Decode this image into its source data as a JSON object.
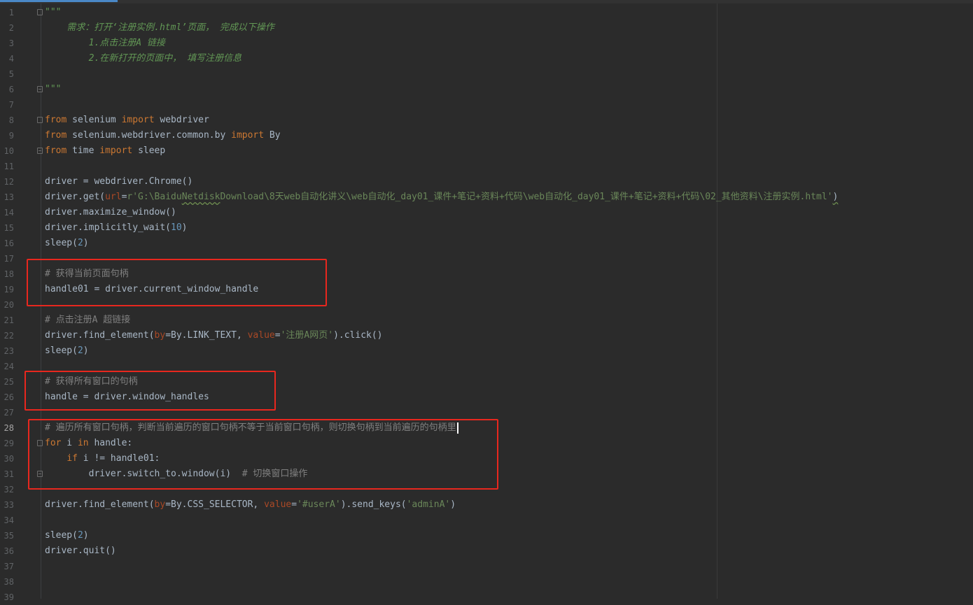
{
  "editor": {
    "current_line": "28",
    "lines": [
      {
        "n": "1",
        "code": [
          {
            "t": "\"\"\"",
            "c": "doc"
          }
        ],
        "fold": "open"
      },
      {
        "n": "2",
        "code": [
          {
            "t": "    需求：打开‘注册实例.html’页面， 完成以下操作",
            "c": "doc"
          }
        ]
      },
      {
        "n": "3",
        "code": [
          {
            "t": "        1.点击注册A 链接",
            "c": "doc"
          }
        ]
      },
      {
        "n": "4",
        "code": [
          {
            "t": "        2.在新打开的页面中， 填写注册信息",
            "c": "doc"
          }
        ]
      },
      {
        "n": "5",
        "code": []
      },
      {
        "n": "6",
        "code": [
          {
            "t": "\"\"\"",
            "c": "doc"
          }
        ],
        "fold": "close"
      },
      {
        "n": "7",
        "code": []
      },
      {
        "n": "8",
        "code": [
          {
            "t": "from",
            "c": "kw"
          },
          {
            "t": " selenium "
          },
          {
            "t": "import",
            "c": "kw"
          },
          {
            "t": " webdriver"
          }
        ],
        "fold": "open"
      },
      {
        "n": "9",
        "code": [
          {
            "t": "from",
            "c": "kw"
          },
          {
            "t": " selenium.webdriver.common.by "
          },
          {
            "t": "import",
            "c": "kw"
          },
          {
            "t": " By"
          }
        ]
      },
      {
        "n": "10",
        "code": [
          {
            "t": "from",
            "c": "kw"
          },
          {
            "t": " time "
          },
          {
            "t": "import",
            "c": "kw"
          },
          {
            "t": " sleep"
          }
        ],
        "fold": "close"
      },
      {
        "n": "11",
        "code": []
      },
      {
        "n": "12",
        "code": [
          {
            "t": "driver = webdriver.Chrome()"
          }
        ]
      },
      {
        "n": "13",
        "code": [
          {
            "t": "driver.get("
          },
          {
            "t": "url",
            "c": "param"
          },
          {
            "t": "="
          },
          {
            "t": "r'G:\\Baidu",
            "c": "str"
          },
          {
            "t": "Netdisk",
            "c": "str wavy"
          },
          {
            "t": "Download\\8天web自动化讲义\\web自动化_day01_课件+笔记+资料+代码\\web自动化_day01_课件+笔记+资料+代码\\02_其他资料\\注册实例.html'",
            "c": "str"
          },
          {
            "t": ")",
            "c": "wavy"
          }
        ]
      },
      {
        "n": "14",
        "code": [
          {
            "t": "driver.maximize_window()"
          }
        ]
      },
      {
        "n": "15",
        "code": [
          {
            "t": "driver.implicitly_wait("
          },
          {
            "t": "10",
            "c": "num"
          },
          {
            "t": ")"
          }
        ]
      },
      {
        "n": "16",
        "code": [
          {
            "t": "sleep("
          },
          {
            "t": "2",
            "c": "num"
          },
          {
            "t": ")"
          }
        ]
      },
      {
        "n": "17",
        "code": []
      },
      {
        "n": "18",
        "code": [
          {
            "t": "# 获得当前页面句柄",
            "c": "cmt"
          }
        ]
      },
      {
        "n": "19",
        "code": [
          {
            "t": "handle01 = driver.current_window_handle"
          }
        ]
      },
      {
        "n": "20",
        "code": []
      },
      {
        "n": "21",
        "code": [
          {
            "t": "# 点击注册A 超链接",
            "c": "cmt"
          }
        ]
      },
      {
        "n": "22",
        "code": [
          {
            "t": "driver.find_element("
          },
          {
            "t": "by",
            "c": "param"
          },
          {
            "t": "=By.LINK_TEXT, "
          },
          {
            "t": "value",
            "c": "param"
          },
          {
            "t": "="
          },
          {
            "t": "'注册A网页'",
            "c": "str"
          },
          {
            "t": ").click()"
          }
        ]
      },
      {
        "n": "23",
        "code": [
          {
            "t": "sleep("
          },
          {
            "t": "2",
            "c": "num"
          },
          {
            "t": ")"
          }
        ]
      },
      {
        "n": "24",
        "code": []
      },
      {
        "n": "25",
        "code": [
          {
            "t": "# 获得所有窗口的句柄",
            "c": "cmt"
          }
        ]
      },
      {
        "n": "26",
        "code": [
          {
            "t": "handle = driver.window_handles"
          }
        ]
      },
      {
        "n": "27",
        "code": []
      },
      {
        "n": "28",
        "code": [
          {
            "t": "# 遍历所有窗口句柄，判断当前遍历的窗口句柄不等于当前窗口句柄，则切换句柄到当前遍历的句柄里",
            "c": "cmt"
          }
        ],
        "caret": true
      },
      {
        "n": "29",
        "code": [
          {
            "t": "for",
            "c": "kw"
          },
          {
            "t": " i "
          },
          {
            "t": "in",
            "c": "kw"
          },
          {
            "t": " handle:"
          }
        ],
        "fold": "open"
      },
      {
        "n": "30",
        "code": [
          {
            "t": "    "
          },
          {
            "t": "if",
            "c": "kw"
          },
          {
            "t": " i != handle01:"
          }
        ]
      },
      {
        "n": "31",
        "code": [
          {
            "t": "        driver.switch_to.window(i)  "
          },
          {
            "t": "# 切换窗口操作",
            "c": "cmt"
          }
        ],
        "fold": "close"
      },
      {
        "n": "32",
        "code": []
      },
      {
        "n": "33",
        "code": [
          {
            "t": "driver.find_element("
          },
          {
            "t": "by",
            "c": "param"
          },
          {
            "t": "=By.CSS_SELECTOR, "
          },
          {
            "t": "value",
            "c": "param"
          },
          {
            "t": "="
          },
          {
            "t": "'#userA'",
            "c": "str"
          },
          {
            "t": ").send_keys("
          },
          {
            "t": "'adminA'",
            "c": "str"
          },
          {
            "t": ")"
          }
        ]
      },
      {
        "n": "34",
        "code": []
      },
      {
        "n": "35",
        "code": [
          {
            "t": "sleep("
          },
          {
            "t": "2",
            "c": "num"
          },
          {
            "t": ")"
          }
        ]
      },
      {
        "n": "36",
        "code": [
          {
            "t": "driver.quit()"
          }
        ]
      },
      {
        "n": "37",
        "code": []
      },
      {
        "n": "38",
        "code": []
      },
      {
        "n": "39",
        "code": []
      }
    ]
  },
  "colors": {
    "background": "#2b2b2b",
    "keyword": "#cc7832",
    "string": "#6a8759",
    "number": "#6897bb",
    "param": "#aa4926",
    "comment": "#808080",
    "docstring": "#629755",
    "annotation_box": "#e8271e"
  }
}
